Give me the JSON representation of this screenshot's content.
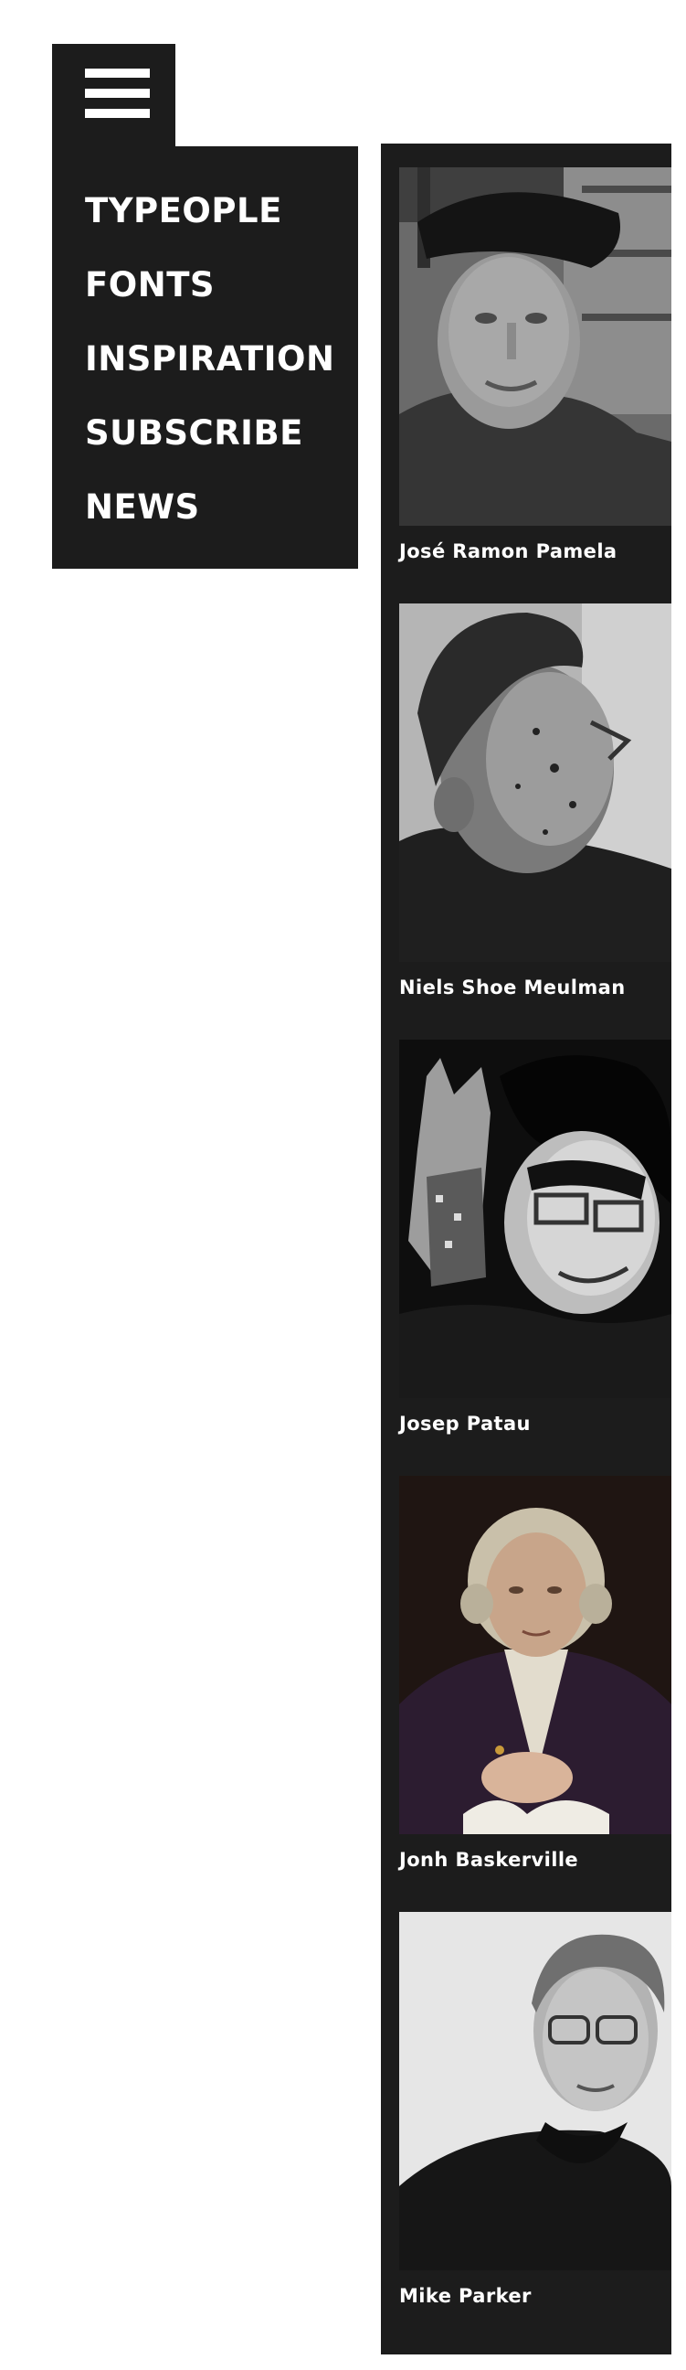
{
  "menu": {
    "toggle_icon": "hamburger-icon",
    "items": [
      "TYPEOPLE",
      "FONTS",
      "INSPIRATION",
      "SUBSCRIBE",
      "NEWS"
    ]
  },
  "people": [
    {
      "name": "José Ramon Pamela",
      "photo": "portrait-photo"
    },
    {
      "name": "Niels Shoe Meulman",
      "photo": "portrait-photo"
    },
    {
      "name": "Josep Patau",
      "photo": "portrait-photo"
    },
    {
      "name": "Jonh Baskerville",
      "photo": "portrait-painting"
    },
    {
      "name": "Mike Parker",
      "photo": "portrait-photo"
    }
  ],
  "colors": {
    "panel": "#1c1c1c",
    "text": "#ffffff",
    "background": "#ffffff"
  }
}
